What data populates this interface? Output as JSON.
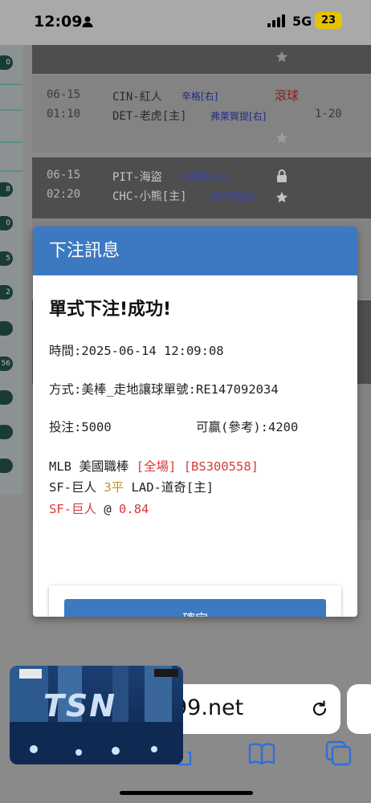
{
  "status_bar": {
    "time": "12:09",
    "network": "5G",
    "battery": "23"
  },
  "left_pills": [
    "0",
    "8",
    "0",
    "5",
    "2",
    "",
    "56",
    "",
    "",
    ""
  ],
  "games": [
    {
      "date": "06-15",
      "time": "01:10",
      "away": "CIN-紅人",
      "away_pitcher": "辛格[右]",
      "home": "DET-老虎[主]",
      "home_pitcher": "弗萊賀提[右]",
      "status": "滾球",
      "score": "1-20"
    },
    {
      "date": "06-15",
      "time": "02:20",
      "away": "PIT-海盜",
      "away_pitcher": "柏羅斯[右]",
      "home": "CHC-小熊[主]",
      "home_pitcher": "波伊德[左]"
    }
  ],
  "dialog": {
    "header": "下注訊息",
    "title": "單式下注!成功!",
    "time_line": "時間:2025-06-14 12:09:08",
    "method_line": "方式:美棒_走地讓球單號:RE147092034",
    "stake_line": "投注:5000",
    "win_line": "可贏(參考):4200",
    "league": "MLB 美國職棒",
    "period": "[全場]",
    "ticket": "[BS300558]",
    "team_away": "SF-巨人",
    "handicap": "3平",
    "team_home": "LAD-道奇[主]",
    "pick_team": "SF-巨人",
    "pick_at": "@",
    "odds": "0.84",
    "confirm_button": "確定"
  },
  "browser": {
    "url": "99.net"
  },
  "video_overlay": {
    "logo_text": "TSN"
  }
}
